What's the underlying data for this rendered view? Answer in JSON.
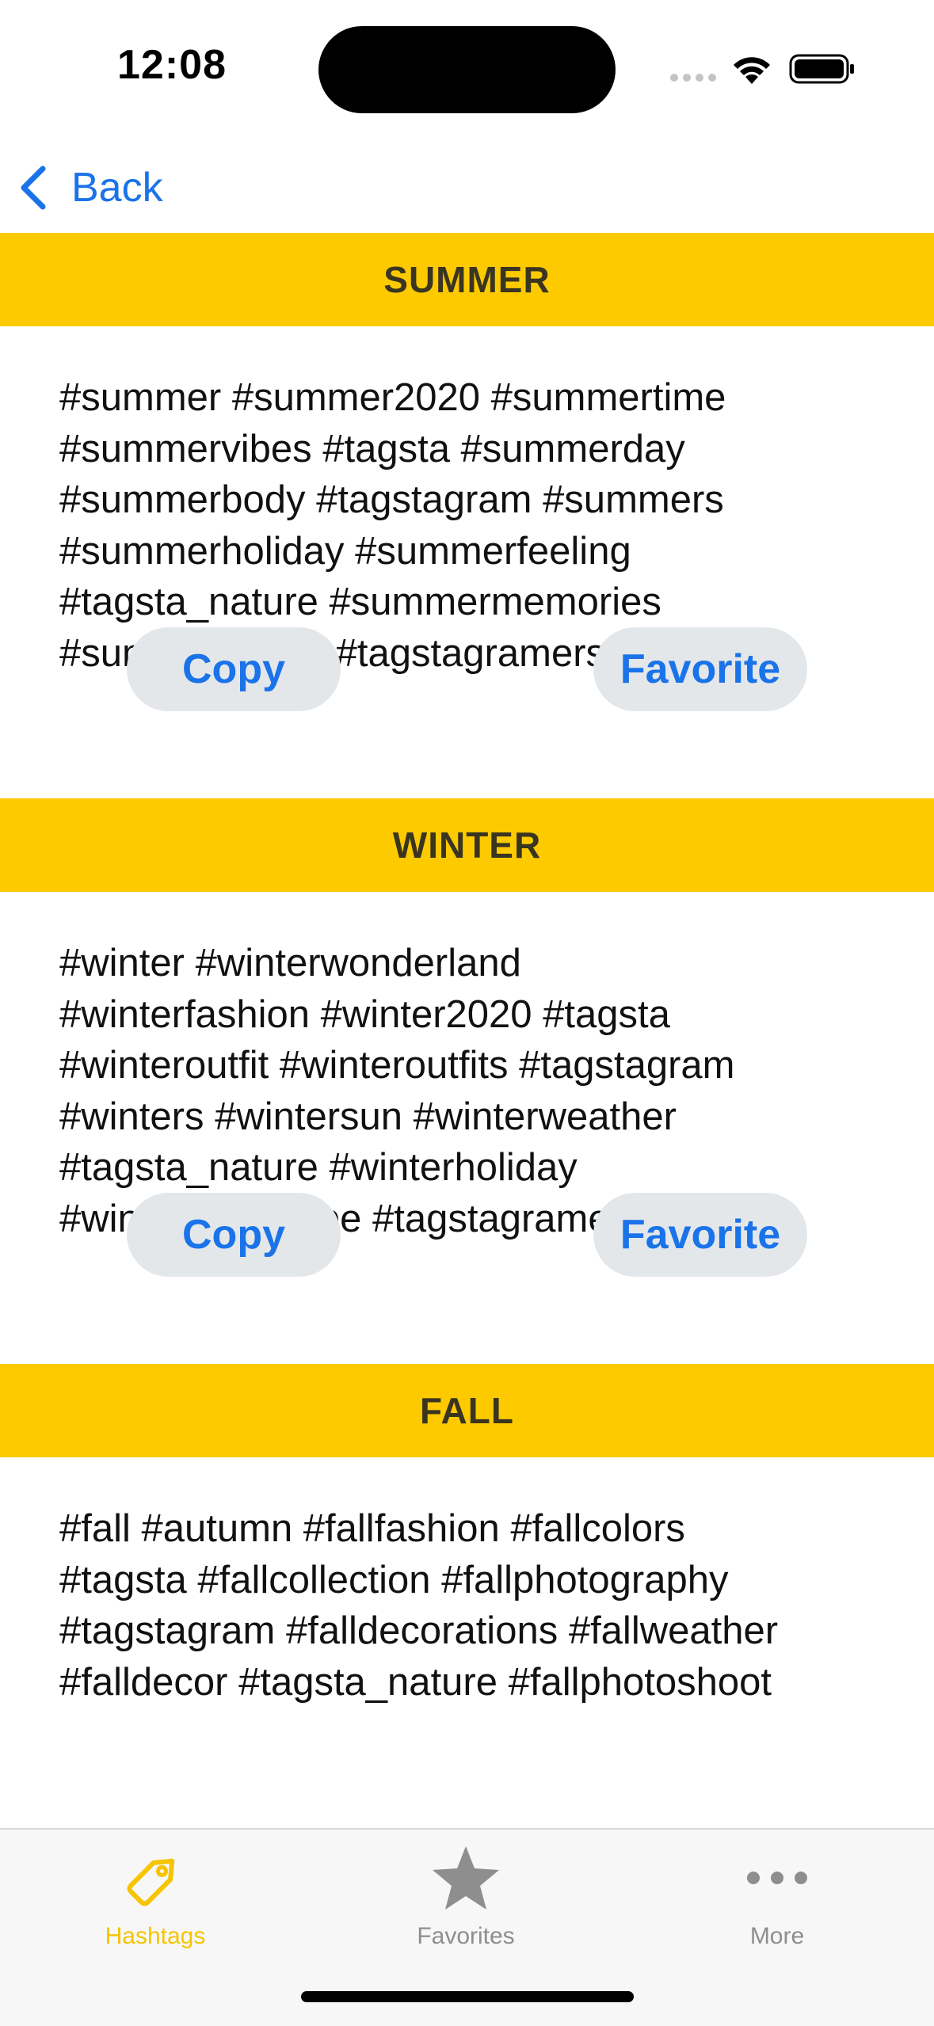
{
  "status_bar": {
    "time": "12:08"
  },
  "nav": {
    "back_label": "Back"
  },
  "sections": [
    {
      "title": "SUMMER",
      "tags": "#summer #summer2020 #summertime\n#summervibes  #tagsta #summerday\n#summerbody #tagstagram #summers\n#summerholiday #summerfeeling\n#tagsta_nature #summermemories\n#summernights #tagstagramers",
      "copy_label": "Copy",
      "favorite_label": "Favorite"
    },
    {
      "title": "WINTER",
      "tags": "#winter #winterwonderland\n#winterfashion #winter2020 #tagsta\n#winteroutfit #winteroutfits #tagstagram\n#winters #wintersun #winterweather\n#tagsta_nature #winterholiday\n#winterlandscape #tagstagramers",
      "copy_label": "Copy",
      "favorite_label": "Favorite"
    },
    {
      "title": "FALL",
      "tags": "#fall #autumn #fallfashion #fallcolors\n#tagsta #fallcollection #fallphotography\n#tagstagram #falldecorations #fallweather\n#falldecor #tagsta_nature #fallphotoshoot"
    }
  ],
  "tabbar": {
    "tabs": [
      {
        "label": "Hashtags",
        "icon": "tag-icon",
        "active": true
      },
      {
        "label": "Favorites",
        "icon": "star-icon",
        "active": false
      },
      {
        "label": "More",
        "icon": "more-icon",
        "active": false
      }
    ]
  },
  "colors": {
    "accent": "#fdca00",
    "link": "#1a73e8",
    "button_bg": "#e4e7ea",
    "active_tab": "#f6c400"
  }
}
